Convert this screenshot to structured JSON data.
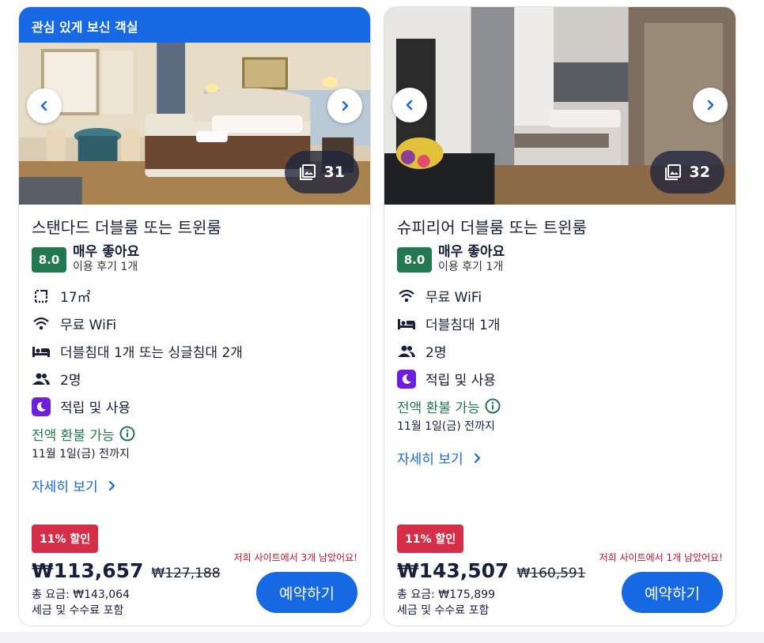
{
  "cards": [
    {
      "ribbon": "관심 있게 보신 객실",
      "photo_count": "31",
      "room_name": "스탠다드 더블룸 또는 트윈룸",
      "score": "8.0",
      "rating_label": "매우 좋아요",
      "review_count": "이용 후기 1개",
      "amenities": [
        {
          "icon": "floor-plan-icon",
          "label": "17㎡"
        },
        {
          "icon": "wifi-icon",
          "label": "무료 WiFi"
        },
        {
          "icon": "bed-icon",
          "label": "더블침대 1개 또는 싱글침대 2개"
        },
        {
          "icon": "people-icon",
          "label": "2명"
        },
        {
          "icon": "moon-icon",
          "label": "적립 및 사용"
        }
      ],
      "refund": "전액 환불 가능",
      "refund_date": "11월 1일(금) 전까지",
      "details": "자세히 보기",
      "discount": "11% 할인",
      "price": "₩113,657",
      "old_price": "₩127,188",
      "scarcity": "저희 사이트에서 3개 남았어요!",
      "total": "총 요금: ₩143,064",
      "tax": "세금 및 수수료 포함",
      "reserve": "예약하기"
    },
    {
      "photo_count": "32",
      "room_name": "슈피리어 더블룸 또는 트윈룸",
      "score": "8.0",
      "rating_label": "매우 좋아요",
      "review_count": "이용 후기 1개",
      "amenities": [
        {
          "icon": "wifi-icon",
          "label": "무료 WiFi"
        },
        {
          "icon": "bed-icon",
          "label": "더블침대 1개"
        },
        {
          "icon": "people-icon",
          "label": "2명"
        },
        {
          "icon": "moon-icon",
          "label": "적립 및 사용"
        }
      ],
      "refund": "전액 환불 가능",
      "refund_date": "11월 1일(금) 전까지",
      "details": "자세히 보기",
      "discount": "11% 할인",
      "price": "₩143,507",
      "old_price": "₩160,591",
      "scarcity": "저희 사이트에서 1개 남았어요!",
      "total": "총 요금: ₩175,899",
      "tax": "세금 및 수수료 포함",
      "reserve": "예약하기"
    }
  ],
  "colors": {
    "brand_blue": "#1668e3",
    "rating_green": "#227950",
    "discount_red": "#d32f48",
    "scarcity_red": "#c60f2d",
    "loyalty_purple": "#6e1fdb"
  }
}
